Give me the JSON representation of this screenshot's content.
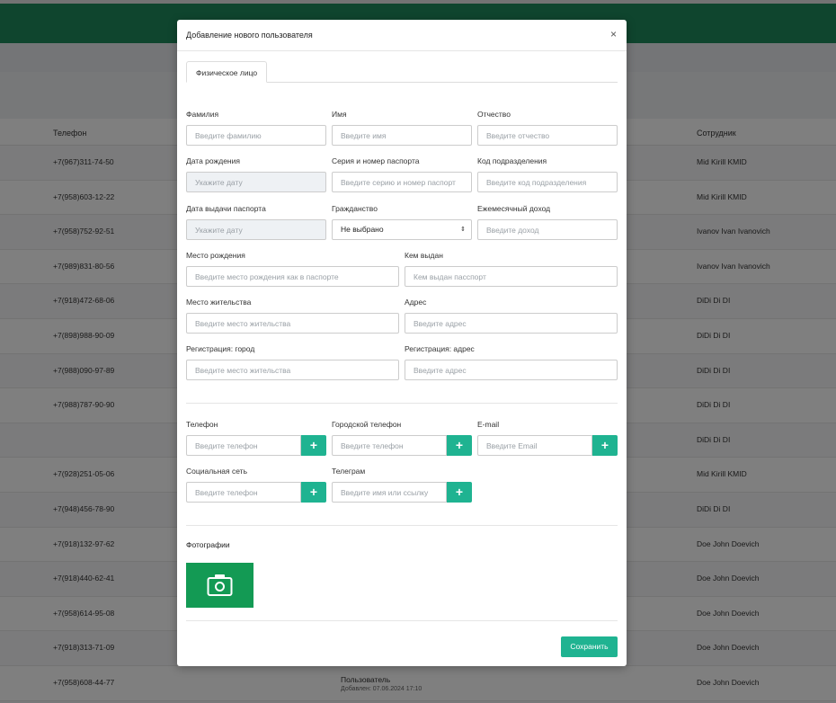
{
  "background": {
    "table_headers": {
      "phone": "Телефон",
      "employee": "Сотрудник"
    },
    "rows": [
      {
        "phone": "+7(967)311-74-50",
        "employee": "Mid Kirill KMID"
      },
      {
        "phone": "+7(958)603-12-22",
        "employee": "Mid Kirill KMID"
      },
      {
        "phone": "+7(958)752-92-51",
        "employee": "Ivanov Ivan Ivanovich"
      },
      {
        "phone": "+7(989)831-80-56",
        "employee": "Ivanov Ivan Ivanovich"
      },
      {
        "phone": "+7(918)472-68-06",
        "employee": "DiDi Di DI"
      },
      {
        "phone": "+7(898)988-90-09",
        "employee": "DiDi Di DI"
      },
      {
        "phone": "+7(988)090-97-89",
        "employee": "DiDi Di DI"
      },
      {
        "phone": "+7(988)787-90-90",
        "employee": "DiDi Di DI"
      },
      {
        "phone": "",
        "employee": "DiDi Di DI"
      },
      {
        "phone": "+7(928)251-05-06",
        "employee": "Mid Kirill KMID"
      },
      {
        "phone": "+7(948)456-78-90",
        "employee": "DiDi Di DI"
      },
      {
        "phone": "+7(918)132-97-62",
        "employee": "Doe John Doevich"
      },
      {
        "phone": "+7(918)440-62-41",
        "employee": "Doe John Doevich"
      },
      {
        "phone": "+7(958)614-95-08",
        "employee": "Doe John Doevich"
      },
      {
        "phone": "+7(918)313-71-09",
        "employee": "Doe John Doevich"
      },
      {
        "phone": "+7(958)608-44-77",
        "employee": "Doe John Doevich",
        "middle": "Пользователь",
        "middle_sub": "Добавлен: 07.06.2024 17:10"
      }
    ]
  },
  "modal": {
    "title": "Добавление нового пользователя",
    "close": "×",
    "tab": "Физическое лицо",
    "fields": {
      "lastname": {
        "label": "Фамилия",
        "placeholder": "Введите фамилию"
      },
      "firstname": {
        "label": "Имя",
        "placeholder": "Введите имя"
      },
      "patronymic": {
        "label": "Отчество",
        "placeholder": "Введите отчество"
      },
      "birthdate": {
        "label": "Дата рождения",
        "placeholder": "Укажите дату"
      },
      "passport": {
        "label": "Серия и номер паспорта",
        "placeholder": "Введите серию и номер паспорт"
      },
      "division_code": {
        "label": "Код подразделения",
        "placeholder": "Введите код подразделения"
      },
      "passport_date": {
        "label": "Дата выдачи паспорта",
        "placeholder": "Укажите дату"
      },
      "citizenship": {
        "label": "Гражданство",
        "value": "Не выбрано"
      },
      "income": {
        "label": "Ежемесячный доход",
        "placeholder": "Введите доход"
      },
      "birthplace": {
        "label": "Место рождения",
        "placeholder": "Введите место рождения как в паспорте"
      },
      "issued_by": {
        "label": "Кем выдан",
        "placeholder": "Кем выдан пасспорт"
      },
      "residence": {
        "label": "Место жительства",
        "placeholder": "Введите место жительства"
      },
      "address": {
        "label": "Адрес",
        "placeholder": "Введите адрес"
      },
      "reg_city": {
        "label": "Регистрация: город",
        "placeholder": "Введите место жительства"
      },
      "reg_address": {
        "label": "Регистрация: адрес",
        "placeholder": "Введите адрес"
      },
      "phone": {
        "label": "Телефон",
        "placeholder": "Введите телефон"
      },
      "city_phone": {
        "label": "Городской телефон",
        "placeholder": "Введите телефон"
      },
      "email": {
        "label": "E-mail",
        "placeholder": "Введите Email"
      },
      "social": {
        "label": "Социальная сеть",
        "placeholder": "Введите телефон"
      },
      "telegram": {
        "label": "Телеграм",
        "placeholder": "Введите имя или ссылку"
      }
    },
    "add_symbol": "+",
    "photos_title": "Фотографии",
    "save_label": "Сохранить"
  },
  "colors": {
    "header_green": "#1f8a5d",
    "accent_teal": "#1fb391",
    "photo_green": "#139a54"
  },
  "icons": [
    "close-icon",
    "plus-icon",
    "camera-icon",
    "select-arrow-icon"
  ]
}
